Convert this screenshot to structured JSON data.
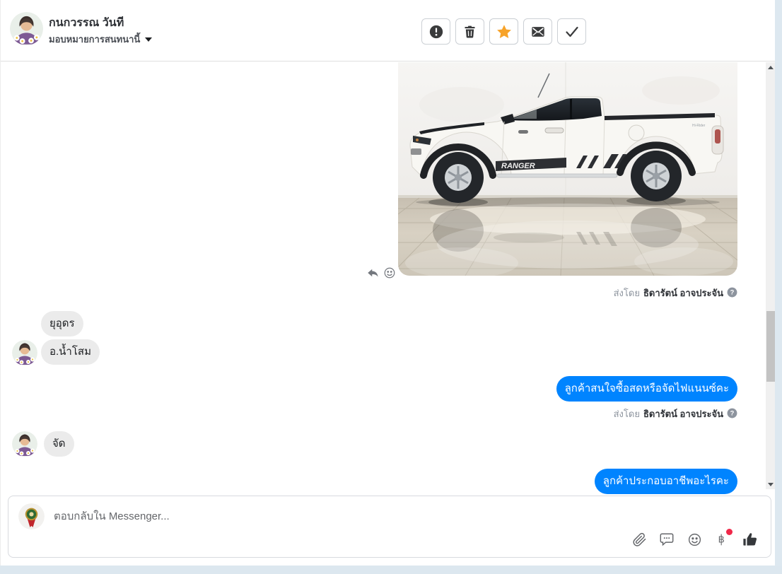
{
  "header": {
    "contact_name": "กนกวรรณ วันที",
    "assign_menu_label": "มอบหมายการสนทนานี้",
    "actions": [
      {
        "name": "report",
        "icon": "exclamation-circle-icon"
      },
      {
        "name": "delete",
        "icon": "trash-icon"
      },
      {
        "name": "follow-up",
        "icon": "star-icon",
        "active": true
      },
      {
        "name": "mark-as-unread",
        "icon": "envelope-icon"
      },
      {
        "name": "mark-as-done",
        "icon": "check-icon"
      }
    ]
  },
  "conversation": {
    "sent_by_label": "ส่งโดย",
    "messages": [
      {
        "type": "image",
        "direction": "outgoing",
        "image_alt": "รถกระบะ Ford Ranger สีขาวในโชว์รูม",
        "sent_by": "ธิดารัตน์ อาจประจัน"
      },
      {
        "type": "text",
        "direction": "incoming",
        "text": "ยุอุดร"
      },
      {
        "type": "text",
        "direction": "incoming",
        "text": "อ.น้ำโสม"
      },
      {
        "type": "text",
        "direction": "outgoing",
        "text": "ลูกค้าสนใจซื้อสดหรือจัดไฟแนนซ์คะ",
        "sent_by": "ธิดารัตน์ อาจประจัน"
      },
      {
        "type": "text",
        "direction": "incoming",
        "text": "จัด"
      },
      {
        "type": "text",
        "direction": "outgoing",
        "text": "ลูกค้าประกอบอาชีพอะไรคะ"
      }
    ],
    "vehicle_decal_text": "RANGER"
  },
  "composer": {
    "placeholder": "ตอบกลับใน Messenger...",
    "icons": [
      "paperclip-icon",
      "saved-replies-icon",
      "emoji-icon",
      "payment-icon",
      "like-icon"
    ],
    "payment_badge": true
  },
  "colors": {
    "accent_blue": "#0084ff",
    "star_orange": "#f7a329",
    "bubble_gray": "#ebebeb",
    "badge_red": "#f02849",
    "page_background": "#dde8f0"
  }
}
